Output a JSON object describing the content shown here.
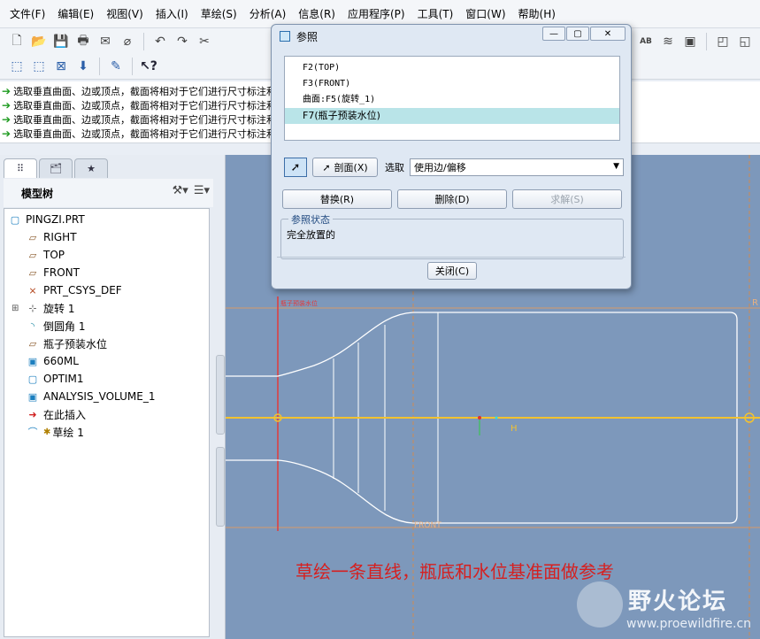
{
  "menubar": [
    "文件(F)",
    "编辑(E)",
    "视图(V)",
    "插入(I)",
    "草绘(S)",
    "分析(A)",
    "信息(R)",
    "应用程序(P)",
    "工具(T)",
    "窗口(W)",
    "帮助(H)"
  ],
  "messages": [
    "选取垂直曲面、边或顶点，截面将相对于它们进行尺寸标注和",
    "选取垂直曲面、边或顶点，截面将相对于它们进行尺寸标注和",
    "选取垂直曲面、边或顶点，截面将相对于它们进行尺寸标注和",
    "选取垂直曲面、边或顶点，截面将相对于它们进行尺寸标注和"
  ],
  "model_tree": {
    "title": "模型树",
    "items": [
      {
        "label": "PINGZI.PRT",
        "level": 0,
        "icon": "part-icon"
      },
      {
        "label": "RIGHT",
        "level": 1,
        "icon": "datum-plane-icon"
      },
      {
        "label": "TOP",
        "level": 1,
        "icon": "datum-plane-icon"
      },
      {
        "label": "FRONT",
        "level": 1,
        "icon": "datum-plane-icon"
      },
      {
        "label": "PRT_CSYS_DEF",
        "level": 1,
        "icon": "csys-icon"
      },
      {
        "label": "旋转 1",
        "level": 1,
        "icon": "revolve-icon",
        "expandable": true
      },
      {
        "label": "倒圆角 1",
        "level": 1,
        "icon": "round-icon"
      },
      {
        "label": "瓶子预装水位",
        "level": 1,
        "icon": "datum-plane-icon"
      },
      {
        "label": "660ML",
        "level": 1,
        "icon": "analysis-icon"
      },
      {
        "label": "OPTIM1",
        "level": 1,
        "icon": "optim-icon"
      },
      {
        "label": "ANALYSIS_VOLUME_1",
        "level": 1,
        "icon": "analysis-icon"
      },
      {
        "label": "在此插入",
        "level": 1,
        "icon": "insert-here-icon"
      },
      {
        "label": "草绘 1",
        "level": 1,
        "icon": "sketch-icon"
      }
    ]
  },
  "dialog": {
    "title": "参照",
    "references": [
      "F2(TOP)",
      "F3(FRONT)",
      "曲面:F5(旋转_1)",
      "F7(瓶子预装水位)"
    ],
    "selected_index": 3,
    "section_button": "剖面(X)",
    "select_label": "选取",
    "select_value": "使用边/偏移",
    "replace_button": "替换(R)",
    "delete_button": "删除(D)",
    "solve_button": "求解(S)",
    "status_group": "参照状态",
    "status_text": "完全放置的",
    "close_button": "关闭(C)"
  },
  "graphics": {
    "labels": {
      "water_plane": "瓶子预装水位",
      "front": "FRONT",
      "right": "R",
      "h_constraint": "H"
    }
  },
  "caption": "草绘一条直线，瓶底和水位基准面做参考",
  "watermark": {
    "title": "野火论坛",
    "url": "www.proewildfire.cn"
  }
}
